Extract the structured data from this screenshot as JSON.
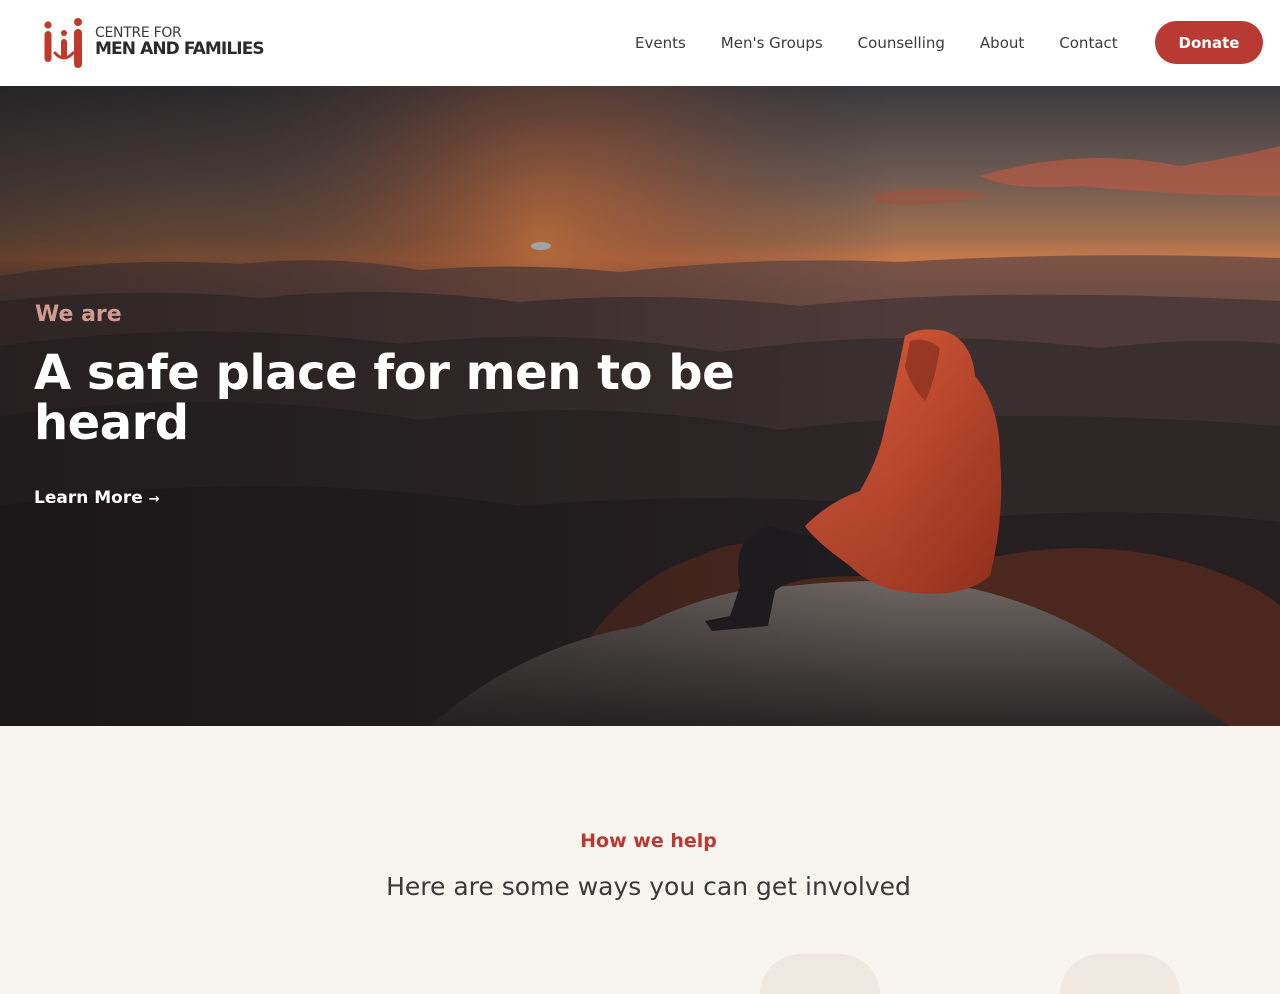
{
  "header": {
    "logo": {
      "line1": "CENTRE FOR",
      "line2": "MEN AND FAMILIES",
      "icon": "family-figures-icon"
    },
    "nav": [
      {
        "label": "Events"
      },
      {
        "label": "Men's Groups"
      },
      {
        "label": "Counselling"
      },
      {
        "label": "About"
      },
      {
        "label": "Contact"
      }
    ],
    "donate_label": "Donate"
  },
  "hero": {
    "eyebrow": "We are",
    "title": "A safe place for men to be heard",
    "cta_label": "Learn More",
    "cta_arrow": "→",
    "image": "man-in-red-hoodie-on-mountain-sunset"
  },
  "help": {
    "eyebrow": "How we help",
    "title": "Here are some ways you can get involved"
  },
  "colors": {
    "brand_red": "#b93a32",
    "eyebrow_pink": "#d19c8f",
    "section_bg": "#f8f5f0",
    "text_dark": "#3b3b3b"
  }
}
